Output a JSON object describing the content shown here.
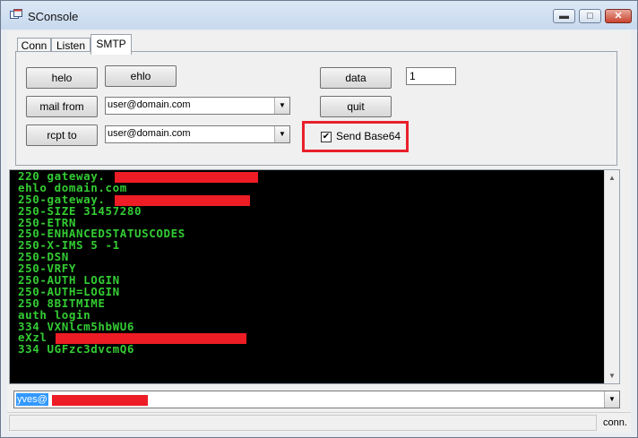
{
  "window": {
    "title": "SConsole",
    "icon": "app-window-icon",
    "controls": {
      "minimize": "minimize-icon",
      "maximize": "maximize-icon",
      "close": "close-icon"
    }
  },
  "tabs": [
    {
      "label": "Conn",
      "active": false
    },
    {
      "label": "Listen",
      "active": false
    },
    {
      "label": "SMTP",
      "active": true
    }
  ],
  "smtp": {
    "helo_label": "helo",
    "ehlo_label": "ehlo",
    "mail_from_label": "mail from",
    "rcpt_to_label": "rcpt to",
    "mail_from_value": "user@domain.com",
    "rcpt_to_value": "user@domain.com",
    "data_label": "data",
    "data_count_value": "1",
    "quit_label": "quit",
    "send_base64_label": "Send Base64",
    "send_base64_checked": true,
    "highlight_color": "#e8202a"
  },
  "console": {
    "text_color": "#33cc33",
    "background": "#000000",
    "redaction_color": "#ee1c24",
    "lines": [
      "220 gateway.",
      "ehlo domain.com",
      "250-gateway.",
      "250-SIZE 31457280",
      "250-ETRN",
      "250-ENHANCEDSTATUSCODES",
      "250-X-IMS 5 -1",
      "250-DSN",
      "250-VRFY",
      "250-AUTH LOGIN",
      "250-AUTH=LOGIN",
      "250 8BITMIME",
      "auth login",
      "334 VXNlcm5hbWU6",
      "eXzl",
      "334 UGFzc3dvcmQ6"
    ]
  },
  "input": {
    "value": "yves@"
  },
  "status": {
    "text": "conn."
  }
}
